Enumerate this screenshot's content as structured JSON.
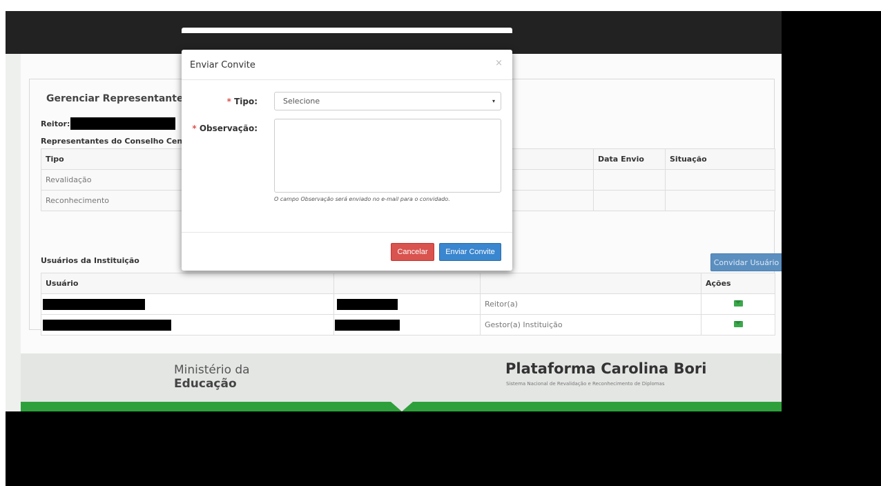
{
  "panel": {
    "title": "Gerenciar Representante do Co",
    "reitor_label": "Reitor:",
    "representantes_label": "Representantes do Conselho Central:",
    "representantes_table": {
      "headers": [
        "Tipo",
        "Data Envio",
        "Situação"
      ],
      "rows": [
        "Revalidação",
        "Reconhecimento"
      ]
    },
    "usuarios_label": "Usuários da Instituição",
    "invite_user_button": "Convidar Usuário",
    "usuarios_table": {
      "headers": [
        "Usuário",
        "Ações"
      ],
      "rows": [
        {
          "perfil": "Reitor(a)"
        },
        {
          "perfil": "Gestor(a) Instituição"
        }
      ]
    }
  },
  "footer": {
    "ministry_line1": "Ministério da",
    "ministry_line2": "Educação",
    "platform_name": "Plataforma Carolina Bori",
    "platform_subtitle": "Sistema Nacional de Revalidação e Reconhecimento de Diplomas"
  },
  "modal": {
    "title": "Enviar Convite",
    "close_glyph": "×",
    "required_mark": "*",
    "tipo_label": "Tipo:",
    "tipo_value": "Selecione",
    "observacao_label": "Observação:",
    "observacao_value": "",
    "help_text": "O campo Observação será enviado no e-mail para o convidado.",
    "cancel_label": "Cancelar",
    "send_label": "Enviar Convite"
  },
  "colors": {
    "danger": "#d9534f",
    "primary": "#3a86cf",
    "brand_green": "#2ea03b"
  },
  "icons": {
    "select_caret": "▾",
    "row_action": "envelope-icon"
  }
}
